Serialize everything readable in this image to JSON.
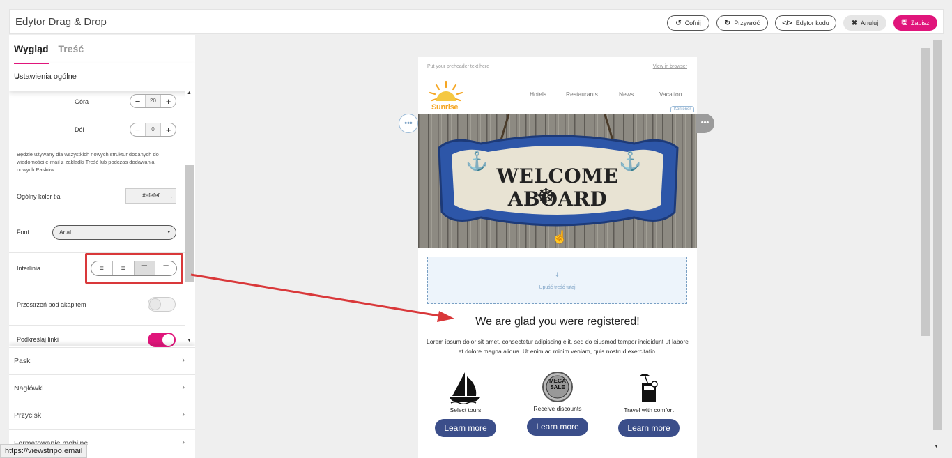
{
  "app": {
    "title": "Edytor Drag & Drop"
  },
  "toolbar": {
    "undo": "Cofnij",
    "redo": "Przywróć",
    "code": "Edytor kodu",
    "cancel": "Anuluj",
    "save": "Zapisz"
  },
  "panel": {
    "tabs": [
      "Wygląd",
      "Treść"
    ],
    "section": "Ustawienia ogólne",
    "top_label": "Góra",
    "top_value": "20",
    "bottom_label": "Dół",
    "bottom_value": "0",
    "note": "Będzie używany dla wszystkich nowych struktur dodanych do wiadomości e-mail z zakładki Treść lub podczas dodawania nowych Pasków",
    "bg_label": "Ogólny kolor tła",
    "bg_value": "#efefef",
    "font_label": "Font",
    "font_value": "Arial",
    "line_label": "Interlinia",
    "line_selected_index": 2,
    "para_label": "Przestrzeń pod akapitem",
    "para_on": false,
    "underline_label": "Podkreślaj linki",
    "underline_on": true,
    "accordion": [
      "Paski",
      "Nagłówki",
      "Przycisk",
      "Formatowanie mobilne"
    ]
  },
  "status_url": "https://viewstripo.email",
  "email": {
    "preheader": "Put your preheader text here",
    "view_in_browser": "View in browser",
    "logo_text": "Sunrise",
    "nav": [
      "Hotels",
      "Restaurants",
      "News",
      "Vacation"
    ],
    "container_tag": "Kontener",
    "hero_text": "WELCOME ABOARD",
    "drop_text": "Upuść treść tutaj",
    "headline": "We are glad you were registered!",
    "body": "Lorem ipsum dolor sit amet, consectetur adipiscing elit, sed do eiusmod tempor incididunt ut labore et dolore magna aliqua. Ut enim ad minim veniam, quis nostrud exercitatio.",
    "features": [
      {
        "icon": "sailboat-icon",
        "label": "Select tours",
        "button": "Learn more"
      },
      {
        "icon": "mega-sale-icon",
        "label": "Receive discounts",
        "button": "Learn more",
        "badge": "MEGA SALE"
      },
      {
        "icon": "cocktail-icon",
        "label": "Travel with comfort",
        "button": "Learn more"
      }
    ]
  },
  "colors": {
    "accent": "#e0157b",
    "button": "#3b4e8a",
    "annotation": "#d9383a"
  }
}
